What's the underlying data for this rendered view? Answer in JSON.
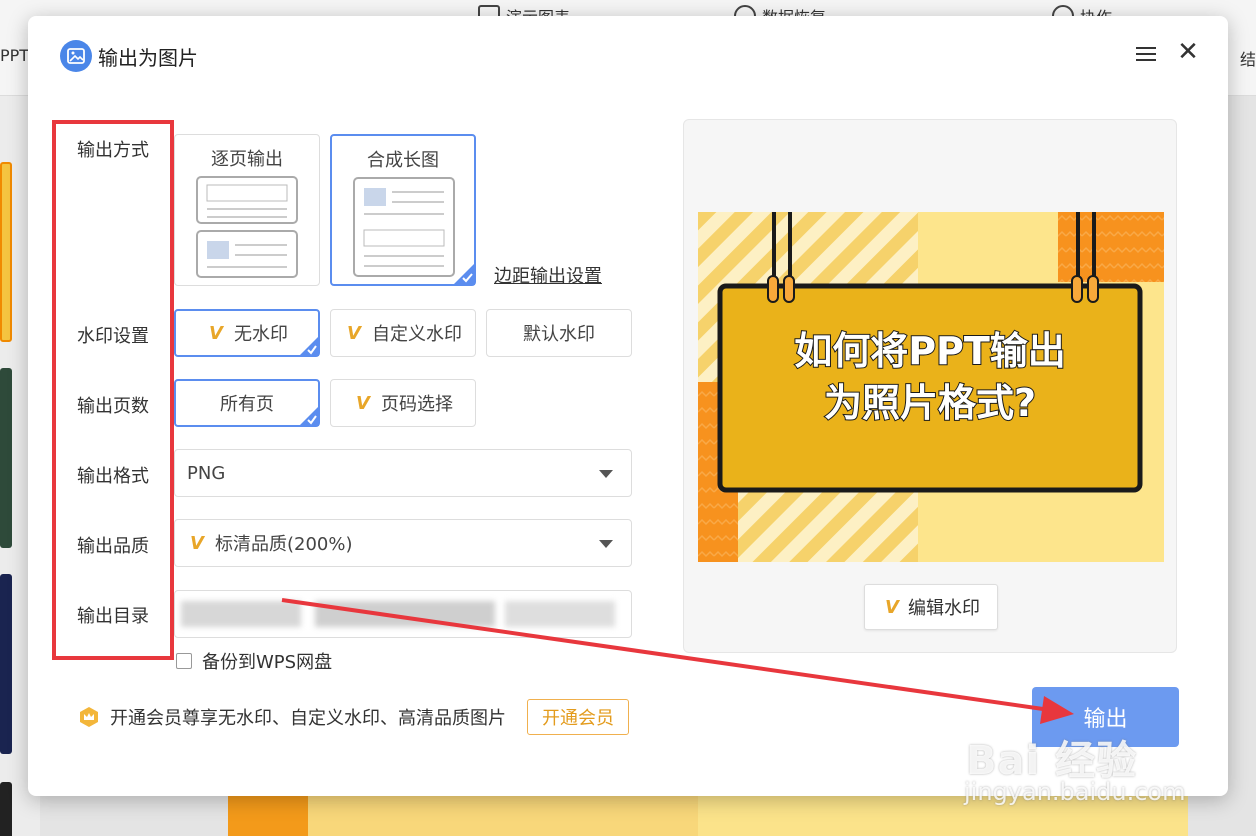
{
  "app": {
    "left_label": "PPT",
    "right_label": "结",
    "toolbar_items": [
      "演示图表",
      "数据恢复",
      "协作"
    ]
  },
  "dialog": {
    "title": "输出为图片"
  },
  "labels": {
    "mode": "输出方式",
    "watermark": "水印设置",
    "pages": "输出页数",
    "format": "输出格式",
    "quality": "输出品质",
    "directory": "输出目录"
  },
  "mode_options": {
    "per_page": "逐页输出",
    "long_image": "合成长图",
    "margin_settings": "边距输出设置"
  },
  "watermark_options": {
    "none": "无水印",
    "custom": "自定义水印",
    "default": "默认水印"
  },
  "page_options": {
    "all": "所有页",
    "select": "页码选择"
  },
  "format_select": {
    "value": "PNG"
  },
  "quality_select": {
    "value": "标清品质(200%)"
  },
  "backup": {
    "label": "备份到WPS网盘"
  },
  "member": {
    "text": "开通会员尊享无水印、自定义水印、高清品质图片",
    "button": "开通会员"
  },
  "preview": {
    "slide_line1": "如何将PPT输出",
    "slide_line2": "为照片格式?",
    "edit_watermark": "编辑水印"
  },
  "export_button": "输出",
  "page_watermark": {
    "main": "Bai 经验",
    "sub": "jingyan.baidu.com"
  },
  "colors": {
    "accent_blue": "#5b8def",
    "export_blue": "#6c9af0",
    "annotation_red": "#e8373d",
    "vip_orange": "#e8a629",
    "slide_yellow": "#eab21a"
  }
}
